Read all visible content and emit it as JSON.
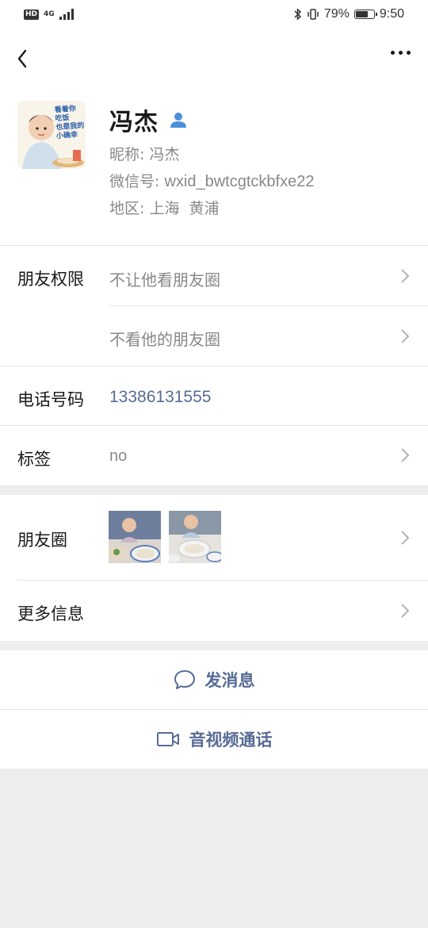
{
  "status_bar": {
    "hd": "HD",
    "network": "4G",
    "battery": "79%",
    "time": "9:50"
  },
  "profile": {
    "name": "冯杰",
    "nickname_label": "昵称:",
    "nickname": "冯杰",
    "wechat_id_label": "微信号:",
    "wechat_id": "wxid_bwtcgtckbfxe22",
    "region_label": "地区:",
    "region": "上海  黄浦",
    "avatar_text": "看着你\n吃饭\n也是我的\n小确幸"
  },
  "permissions": {
    "label": "朋友权限",
    "option1": "不让他看朋友圈",
    "option2": "不看他的朋友圈"
  },
  "phone": {
    "label": "电话号码",
    "value": "13386131555"
  },
  "tags": {
    "label": "标签",
    "value": "no"
  },
  "moments": {
    "label": "朋友圈"
  },
  "more_info": {
    "label": "更多信息"
  },
  "actions": {
    "message": "发消息",
    "call": "音视频通话"
  },
  "colors": {
    "link": "#576b95",
    "background": "#ededed"
  }
}
